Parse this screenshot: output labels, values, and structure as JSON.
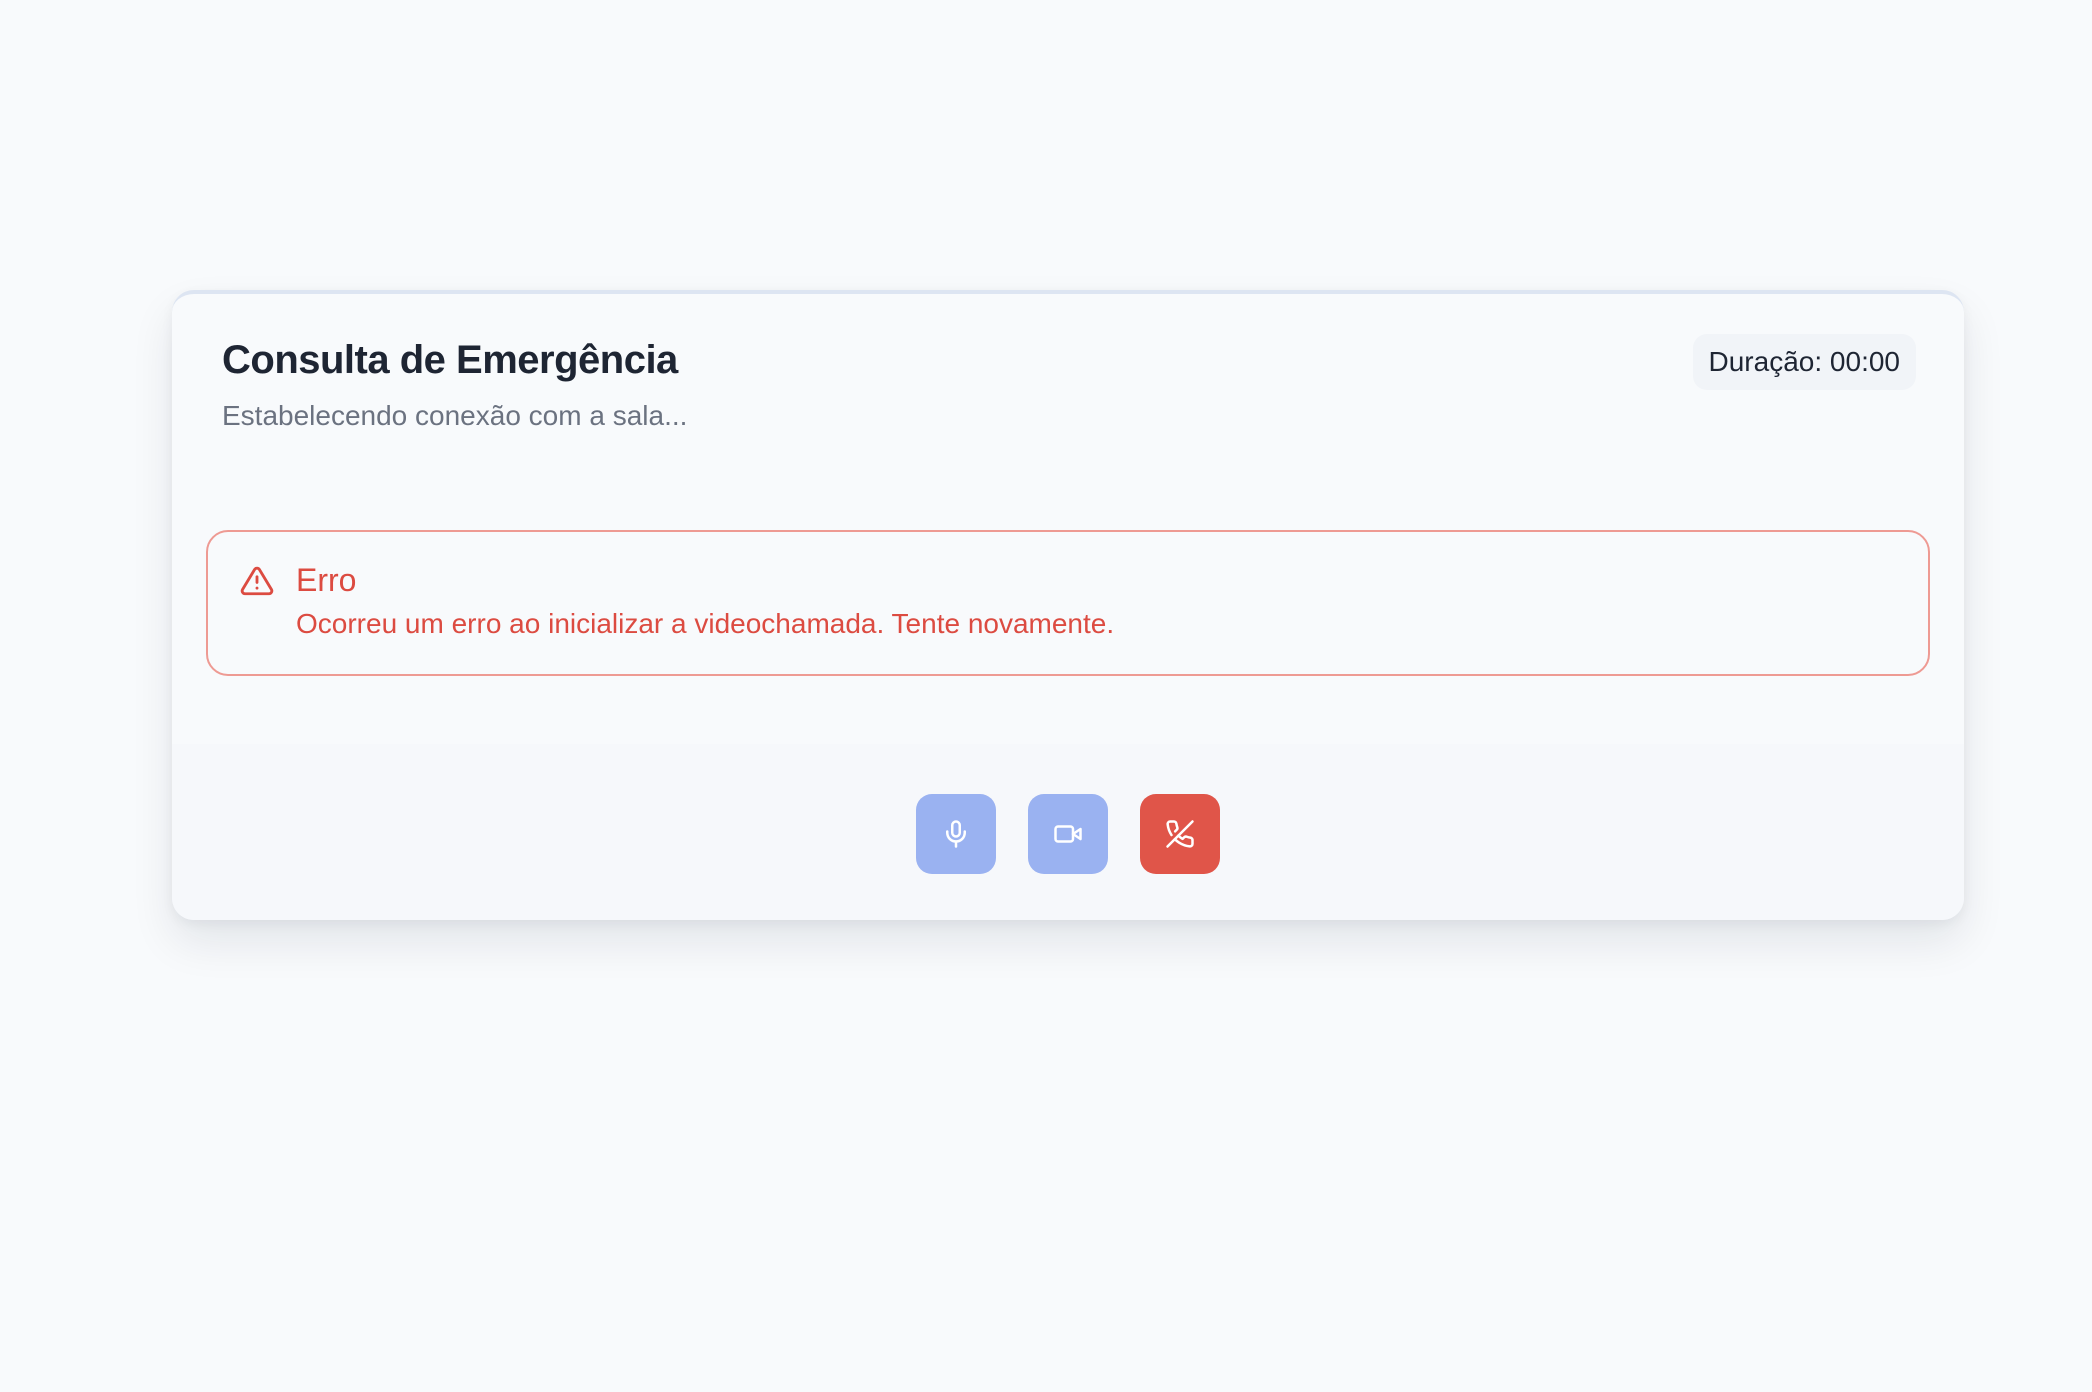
{
  "call": {
    "title": "Consulta de Emergência",
    "status": "Estabelecendo conexão com a sala...",
    "duration_label": "Duração:",
    "duration_value": "00:00"
  },
  "error": {
    "icon": "alert-triangle-icon",
    "title": "Erro",
    "message": "Ocorreu um erro ao inicializar a videochamada. Tente novamente."
  },
  "controls": {
    "mic_icon": "microphone-icon",
    "camera_icon": "video-camera-icon",
    "end_call_icon": "phone-off-icon"
  },
  "colors": {
    "background": "#f8fafc",
    "title": "#1e2533",
    "muted_text": "#6b7280",
    "error": "#dc4b41",
    "error_border": "#ee9a93",
    "control_button": "#9ab2f1",
    "end_call_button": "#e05549"
  }
}
